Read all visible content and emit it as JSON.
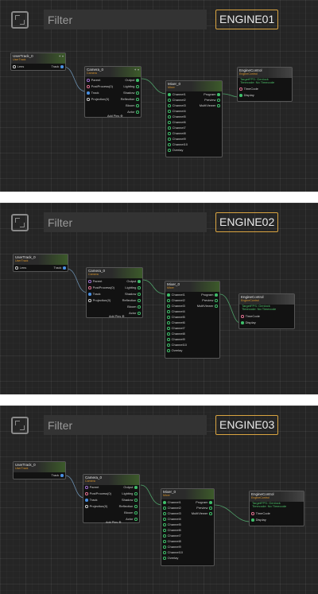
{
  "search": {
    "placeholder": "Filter"
  },
  "panels": [
    {
      "engine_label": "ENGINE01"
    },
    {
      "engine_label": "ENGINE02"
    },
    {
      "engine_label": "ENGINE03"
    }
  ],
  "nodes": {
    "usertrack": {
      "title": "UserTrack_0",
      "sub": "UserTrack",
      "in": "Lens",
      "out": "Track"
    },
    "camera": {
      "title": "Camera_0",
      "sub": "Camera",
      "inputs": [
        "Parent",
        "PostProcess(0)",
        "Track",
        "Projection(0)"
      ],
      "outputs": [
        "Output",
        "Lighting",
        "Shadow",
        "Reflection",
        "Bloom",
        "Actor"
      ],
      "add_pins": "Add Pins"
    },
    "mixer": {
      "title": "Mixer_0",
      "sub": "Mixer",
      "inputs": [
        "Channel1",
        "Channel2",
        "Channel3",
        "Channel4",
        "Channel5",
        "Channel6",
        "Channel7",
        "Channel8",
        "Channel9",
        "Channel10",
        "Overlay"
      ],
      "outputs": [
        "Program",
        "Preview",
        "MultiViewer"
      ]
    },
    "enginecontrol": {
      "title": "EngineControl",
      "sub": "EngineControl",
      "target_line1": "TargetFPS: Genlock",
      "target_line2": "Timecode: No Timecode",
      "inputs": [
        "TimeCode",
        "Display"
      ]
    }
  },
  "icons": {
    "header": "pin-dropdown-icons",
    "frame": "frame-all-icon"
  },
  "colors": {
    "accent_border": "#d9a441",
    "pin_green": "#3fbf6a",
    "pin_blue": "#4a90e2",
    "subtitle": "#d9942b"
  }
}
